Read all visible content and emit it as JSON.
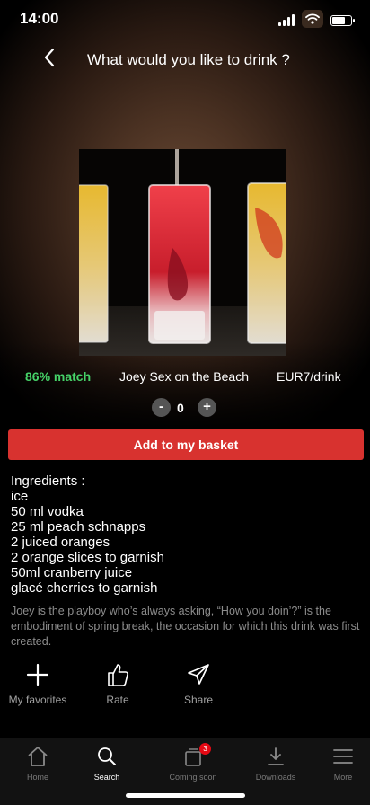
{
  "status_bar": {
    "time": "14:00"
  },
  "header": {
    "title": "What would you like to drink ?"
  },
  "drink": {
    "match": "86% match",
    "name": "Joey Sex on the Beach",
    "price": "EUR7/drink"
  },
  "stepper": {
    "minus": "-",
    "quantity": "0",
    "plus": "+"
  },
  "basket_button": "Add to my basket",
  "ingredients": {
    "heading": "Ingredients :",
    "items": [
      "ice",
      "50 ml vodka",
      "25 ml peach schnapps",
      "2 juiced oranges",
      "2 orange slices to garnish",
      "50ml cranberry juice",
      "glacé cherries to garnish"
    ]
  },
  "description": "Joey is the playboy who’s always asking, “How you doin’?” is the embodiment of spring break, the occasion for which this drink was first created.",
  "actions": [
    {
      "label": "My favorites",
      "icon": "plus-icon"
    },
    {
      "label": "Rate",
      "icon": "thumbs-up-icon"
    },
    {
      "label": "Share",
      "icon": "send-icon"
    }
  ],
  "bottom_nav": [
    {
      "label": "Home",
      "icon": "home-icon"
    },
    {
      "label": "Search",
      "icon": "search-icon",
      "active": true
    },
    {
      "label": "Coming soon",
      "icon": "coming-soon-icon",
      "badge": "3"
    },
    {
      "label": "Downloads",
      "icon": "download-icon"
    },
    {
      "label": "More",
      "icon": "menu-icon"
    }
  ],
  "colors": {
    "match": "#46d369",
    "basket": "#d8322f",
    "badge": "#e50914"
  }
}
